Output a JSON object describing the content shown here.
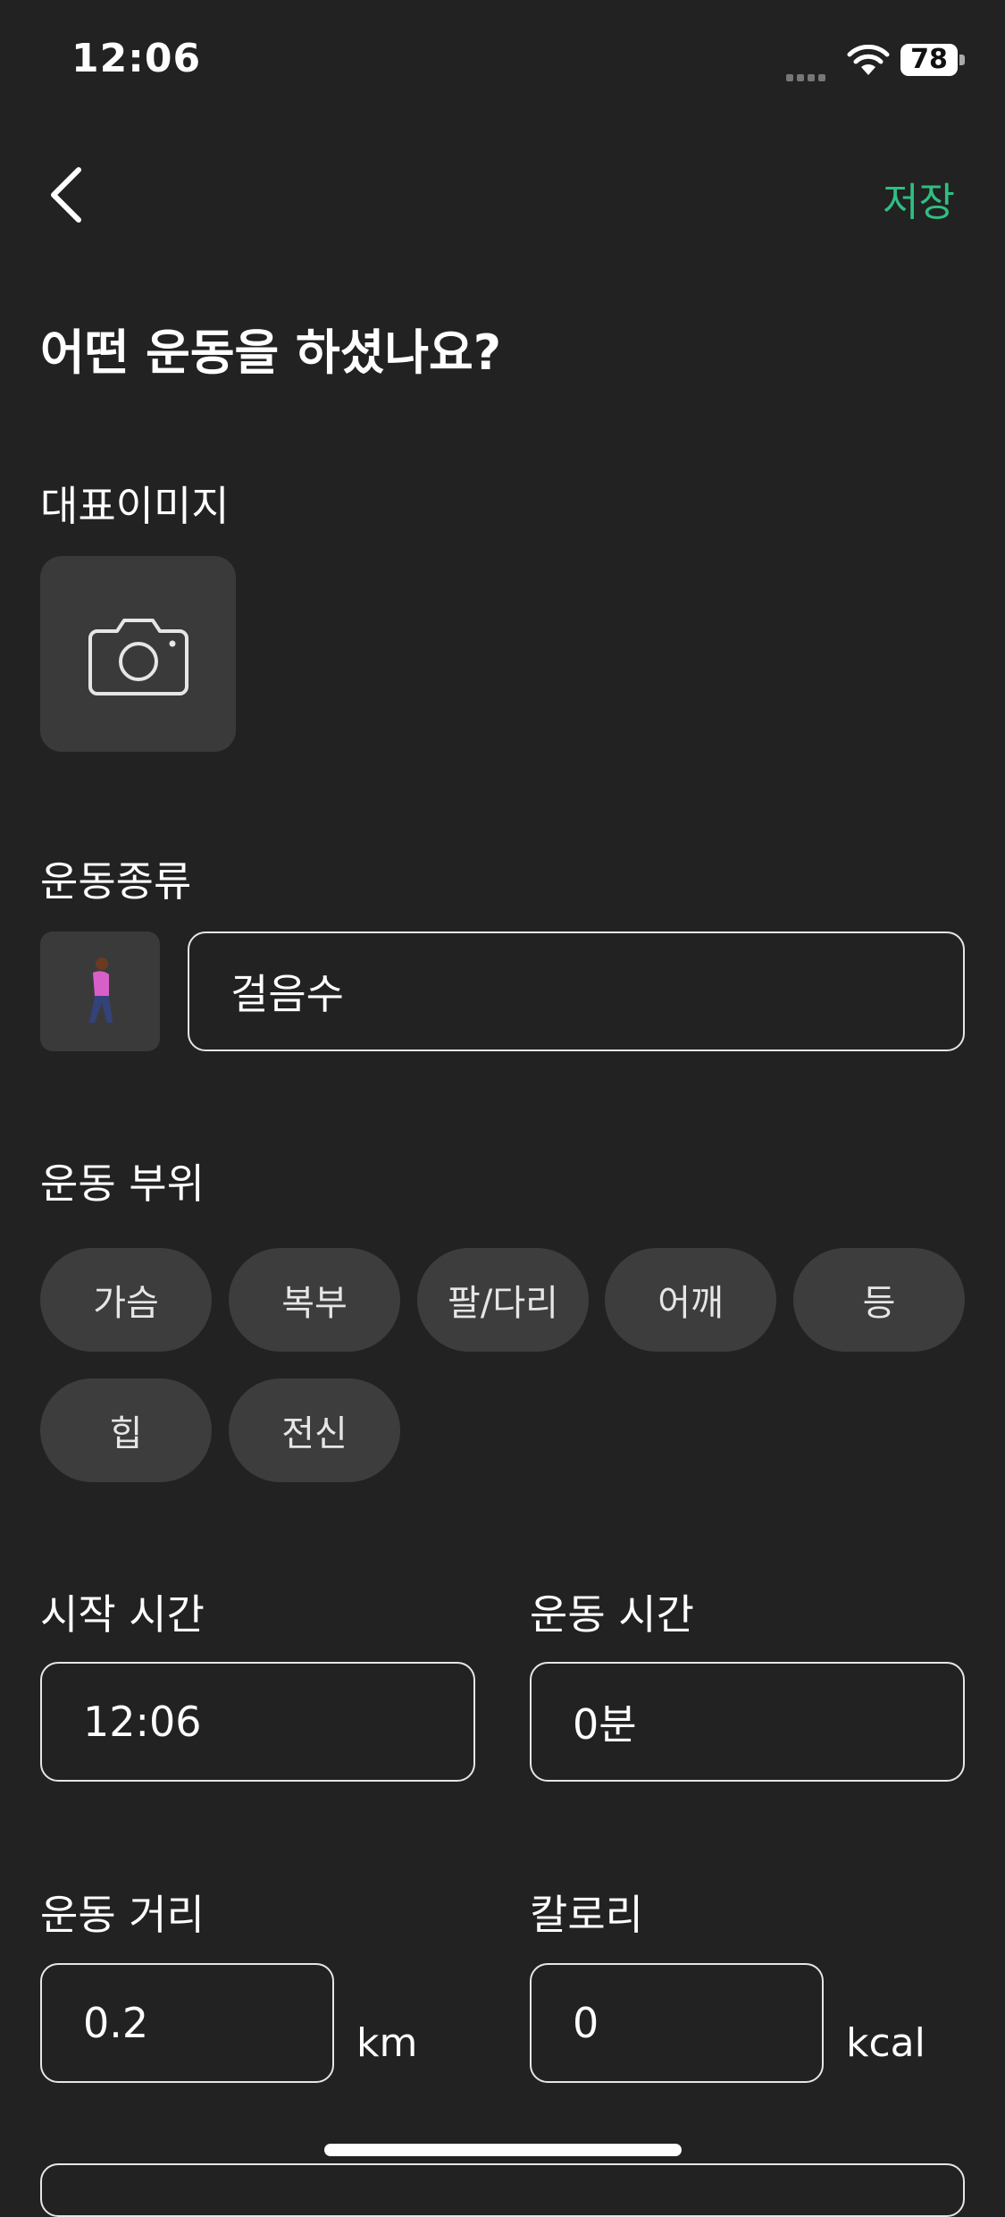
{
  "status": {
    "time": "12:06",
    "battery": "78"
  },
  "header": {
    "save_label": "저장"
  },
  "title": "어떤 운동을 하셨나요?",
  "image_section": {
    "label": "대표이미지"
  },
  "type_section": {
    "label": "운동종류",
    "icon": "person-walking-icon",
    "value": "걸음수"
  },
  "parts_section": {
    "label": "운동 부위",
    "chips": [
      "가슴",
      "복부",
      "팔/다리",
      "어깨",
      "등",
      "힙",
      "전신"
    ]
  },
  "start_time": {
    "label": "시작 시간",
    "value": "12:06"
  },
  "duration": {
    "label": "운동 시간",
    "value": "0분"
  },
  "distance": {
    "label": "운동 거리",
    "value": "0.2",
    "unit": "km"
  },
  "calories": {
    "label": "칼로리",
    "value": "0",
    "unit": "kcal"
  },
  "colors": {
    "background": "#222222",
    "accent": "#2fbf82",
    "chip_bg": "#3d3d3d"
  }
}
